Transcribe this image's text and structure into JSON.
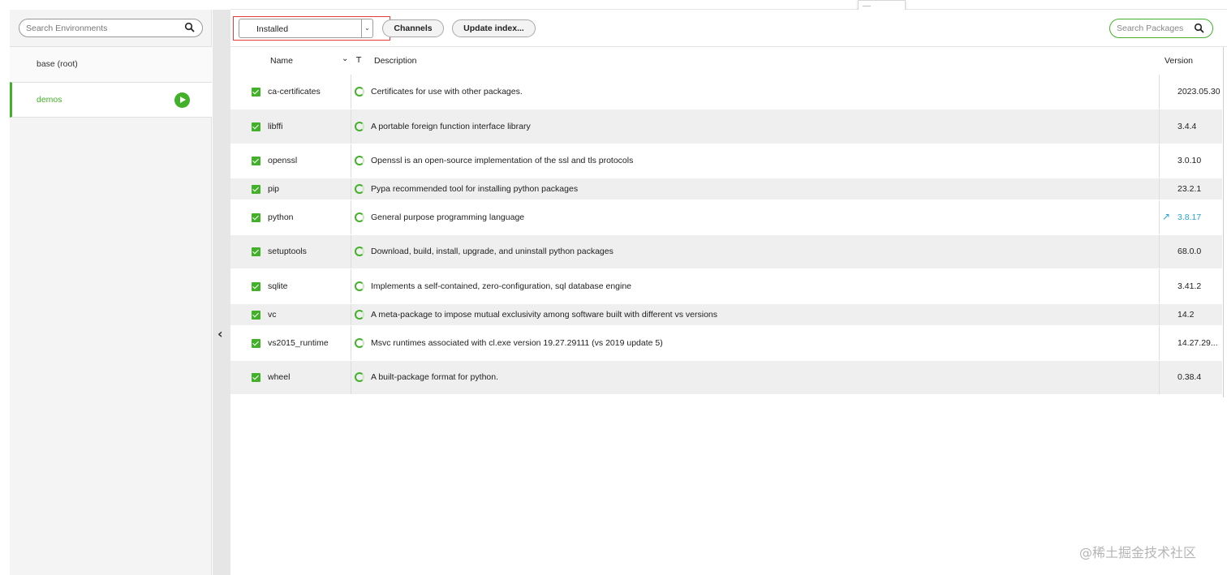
{
  "environments": {
    "search_placeholder": "Search Environments",
    "items": [
      {
        "name": "base (root)",
        "active": false
      },
      {
        "name": "demos",
        "active": true
      }
    ]
  },
  "toolbar": {
    "filter_selected": "Installed",
    "channels_label": "Channels",
    "update_index_label": "Update index...",
    "search_packages_placeholder": "Search Packages"
  },
  "table": {
    "headers": {
      "name": "Name",
      "type": "T",
      "description": "Description",
      "version": "Version"
    },
    "rows": [
      {
        "name": "ca-certificates",
        "description": "Certificates for use with other packages.",
        "version": "2023.05.30",
        "update": false,
        "height": 43
      },
      {
        "name": "libffi",
        "description": "A portable foreign function interface library",
        "version": "3.4.4",
        "update": false,
        "height": 43
      },
      {
        "name": "openssl",
        "description": "Openssl is an open-source implementation of the ssl and tls protocols",
        "version": "3.0.10",
        "update": false,
        "height": 42
      },
      {
        "name": "pip",
        "description": "Pypa recommended tool for installing python packages",
        "version": "23.2.1",
        "update": false,
        "height": 27
      },
      {
        "name": "python",
        "description": "General purpose programming language",
        "version": "3.8.17",
        "update": true,
        "height": 43
      },
      {
        "name": "setuptools",
        "description": "Download, build, install, upgrade, and uninstall python packages",
        "version": "68.0.0",
        "update": false,
        "height": 42
      },
      {
        "name": "sqlite",
        "description": "Implements a self-contained, zero-configuration, sql database engine",
        "version": "3.41.2",
        "update": false,
        "height": 43
      },
      {
        "name": "vc",
        "description": "A meta-package to impose mutual exclusivity among software built with different vs versions",
        "version": "14.2",
        "update": false,
        "height": 27
      },
      {
        "name": "vs2015_runtime",
        "description": "Msvc runtimes associated with cl.exe version 19.27.29111 (vs 2019 update 5)",
        "version": "14.27.29...",
        "update": false,
        "height": 43
      },
      {
        "name": "wheel",
        "description": "A built-package format for python.",
        "version": "0.38.4",
        "update": false,
        "height": 42
      }
    ]
  },
  "watermark": "@稀土掘金技术社区",
  "colors": {
    "accent": "#43b02a",
    "update_link": "#2aa4d5",
    "highlight": "#e53935"
  }
}
